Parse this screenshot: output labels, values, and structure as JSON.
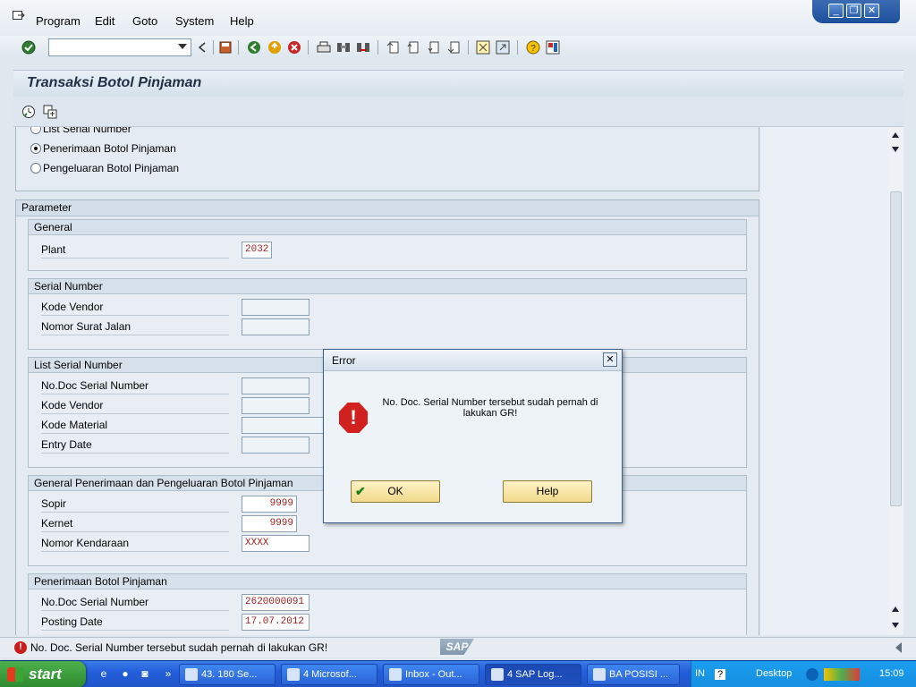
{
  "menu": {
    "items": [
      "Program",
      "Edit",
      "Goto",
      "System",
      "Help"
    ]
  },
  "window_controls": {
    "minimize": "_",
    "restore": "❐",
    "close": "✕"
  },
  "toolbar": {
    "command_field_value": ""
  },
  "page": {
    "title": "Transaksi Botol Pinjaman"
  },
  "radios": [
    {
      "label": "List Serial Number",
      "selected": false
    },
    {
      "label": "Penerimaan Botol Pinjaman",
      "selected": true
    },
    {
      "label": "Pengeluaran Botol Pinjaman",
      "selected": false
    }
  ],
  "parameter": {
    "title": "Parameter",
    "general": {
      "title": "General",
      "plant_label": "Plant",
      "plant_value": "2032"
    },
    "serial_number": {
      "title": "Serial Number",
      "kode_vendor_label": "Kode Vendor",
      "kode_vendor_value": "",
      "nomor_surat_jalan_label": "Nomor Surat Jalan",
      "nomor_surat_jalan_value": ""
    },
    "list_serial_number": {
      "title": "List Serial Number",
      "no_doc_label": "No.Doc Serial Number",
      "no_doc_value": "",
      "kode_vendor_label": "Kode Vendor",
      "kode_vendor_value": "",
      "kode_material_label": "Kode Material",
      "kode_material_value": "",
      "entry_date_label": "Entry Date",
      "entry_date_value": ""
    },
    "general_pp": {
      "title": "General Penerimaan dan Pengeluaran Botol Pinjaman",
      "sopir_label": "Sopir",
      "sopir_value": "9999",
      "kernet_label": "Kernet",
      "kernet_value": "9999",
      "nomor_kendaraan_label": "Nomor Kendaraan",
      "nomor_kendaraan_value": "XXXX"
    },
    "penerimaan": {
      "title": "Penerimaan Botol Pinjaman",
      "no_doc_label": "No.Doc Serial Number",
      "no_doc_value": "2620000091",
      "posting_date_label": "Posting Date",
      "posting_date_value": "17.07.2012"
    }
  },
  "dialog": {
    "title": "Error",
    "close_glyph": "✕",
    "message": "No. Doc. Serial Number tersebut sudah pernah di lakukan GR!",
    "ok_label": "OK",
    "help_label": "Help"
  },
  "status": {
    "message": "No. Doc. Serial Number tersebut sudah pernah di lakukan GR!",
    "logo_text": "SAP"
  },
  "taskbar": {
    "start_label": "start",
    "tasks": [
      {
        "label": "43. 180 Se...",
        "active": false
      },
      {
        "label": "4 Microsof...",
        "active": false
      },
      {
        "label": "Inbox - Out...",
        "active": false
      },
      {
        "label": "4 SAP Log...",
        "active": true
      },
      {
        "label": "BA POSISI ...",
        "active": false
      }
    ],
    "lang": "IN",
    "desktop_label": "Desktop",
    "clock": "15:09"
  },
  "colors": {
    "error_red": "#c81d1d",
    "field_text_red": "#9b1f1f",
    "taskbar_blue": "#245edb",
    "button_gold": "#f0d98a"
  }
}
